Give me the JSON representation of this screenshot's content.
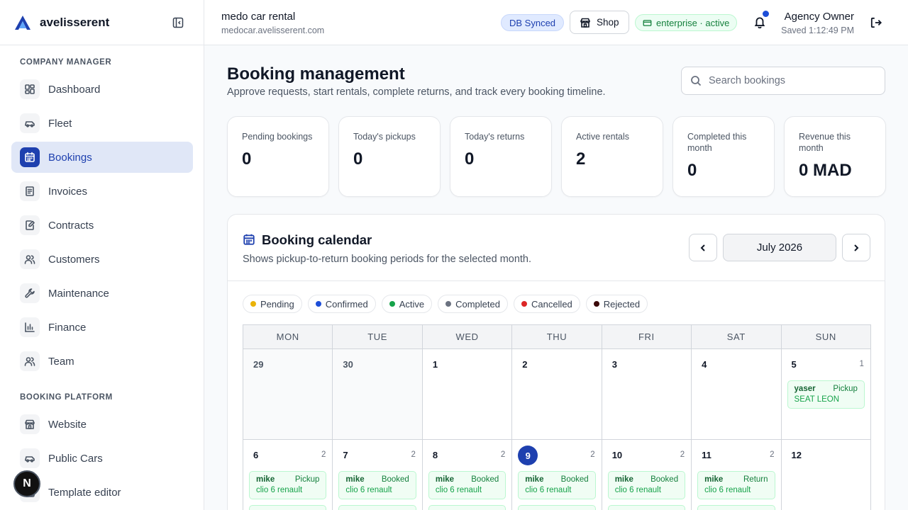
{
  "brand": {
    "name": "avelisserent"
  },
  "sidebar": {
    "sections": [
      {
        "title": "COMPANY MANAGER"
      },
      {
        "title": "BOOKING PLATFORM"
      }
    ],
    "items": [
      {
        "label": "Dashboard",
        "icon": "dashboard-icon"
      },
      {
        "label": "Fleet",
        "icon": "car-icon"
      },
      {
        "label": "Bookings",
        "icon": "calendar-icon",
        "active": true
      },
      {
        "label": "Invoices",
        "icon": "invoice-icon"
      },
      {
        "label": "Contracts",
        "icon": "contract-icon"
      },
      {
        "label": "Customers",
        "icon": "users-icon"
      },
      {
        "label": "Maintenance",
        "icon": "wrench-icon"
      },
      {
        "label": "Finance",
        "icon": "bar-chart-icon"
      },
      {
        "label": "Team",
        "icon": "team-icon"
      },
      {
        "label": "Website",
        "icon": "store-icon"
      },
      {
        "label": "Public Cars",
        "icon": "car-icon"
      },
      {
        "label": "Template editor",
        "icon": "template-icon"
      }
    ],
    "badge": "N"
  },
  "header": {
    "company_name": "medo car rental",
    "company_domain": "medocar.avelisserent.com",
    "db_status": "DB Synced",
    "shop_label": "Shop",
    "plan_status": "enterprise · active",
    "user_name": "Agency Owner",
    "saved_text": "Saved 1:12:49 PM"
  },
  "page": {
    "title": "Booking management",
    "subtitle": "Approve requests, start rentals, complete returns, and track every booking timeline.",
    "search_placeholder": "Search bookings"
  },
  "stats": [
    {
      "label": "Pending bookings",
      "value": "0"
    },
    {
      "label": "Today's pickups",
      "value": "0"
    },
    {
      "label": "Today's returns",
      "value": "0"
    },
    {
      "label": "Active rentals",
      "value": "2"
    },
    {
      "label": "Completed this month",
      "value": "0"
    },
    {
      "label": "Revenue this month",
      "value": "0 MAD"
    }
  ],
  "calendar": {
    "title": "Booking calendar",
    "subtitle": "Shows pickup-to-return booking periods for the selected month.",
    "month": "July 2026",
    "legend": [
      {
        "label": "Pending",
        "color": "#eab308"
      },
      {
        "label": "Confirmed",
        "color": "#1d4ed8"
      },
      {
        "label": "Active",
        "color": "#16a34a"
      },
      {
        "label": "Completed",
        "color": "#6b7280"
      },
      {
        "label": "Cancelled",
        "color": "#dc2626"
      },
      {
        "label": "Rejected",
        "color": "#3b0a0a"
      }
    ],
    "weekdays": [
      "MON",
      "TUE",
      "WED",
      "THU",
      "FRI",
      "SAT",
      "SUN"
    ],
    "weeks": [
      [
        {
          "day": "29",
          "other": true
        },
        {
          "day": "30",
          "other": true
        },
        {
          "day": "1"
        },
        {
          "day": "2"
        },
        {
          "day": "3"
        },
        {
          "day": "4"
        },
        {
          "day": "5",
          "count": "1",
          "event": {
            "who": "yaser",
            "status": "Pickup",
            "car": "SEAT LEON"
          }
        }
      ],
      [
        {
          "day": "6",
          "count": "2",
          "event": {
            "who": "mike",
            "status": "Pickup",
            "car": "clio 6 renault"
          },
          "more": true
        },
        {
          "day": "7",
          "count": "2",
          "event": {
            "who": "mike",
            "status": "Booked",
            "car": "clio 6 renault"
          },
          "more": true
        },
        {
          "day": "8",
          "count": "2",
          "event": {
            "who": "mike",
            "status": "Booked",
            "car": "clio 6 renault"
          },
          "more": true
        },
        {
          "day": "9",
          "count": "2",
          "today": true,
          "event": {
            "who": "mike",
            "status": "Booked",
            "car": "clio 6 renault"
          },
          "more": true
        },
        {
          "day": "10",
          "count": "2",
          "event": {
            "who": "mike",
            "status": "Booked",
            "car": "clio 6 renault"
          },
          "more": true
        },
        {
          "day": "11",
          "count": "2",
          "event": {
            "who": "mike",
            "status": "Return",
            "car": "clio 6 renault"
          },
          "more": true
        },
        {
          "day": "12"
        }
      ]
    ]
  }
}
